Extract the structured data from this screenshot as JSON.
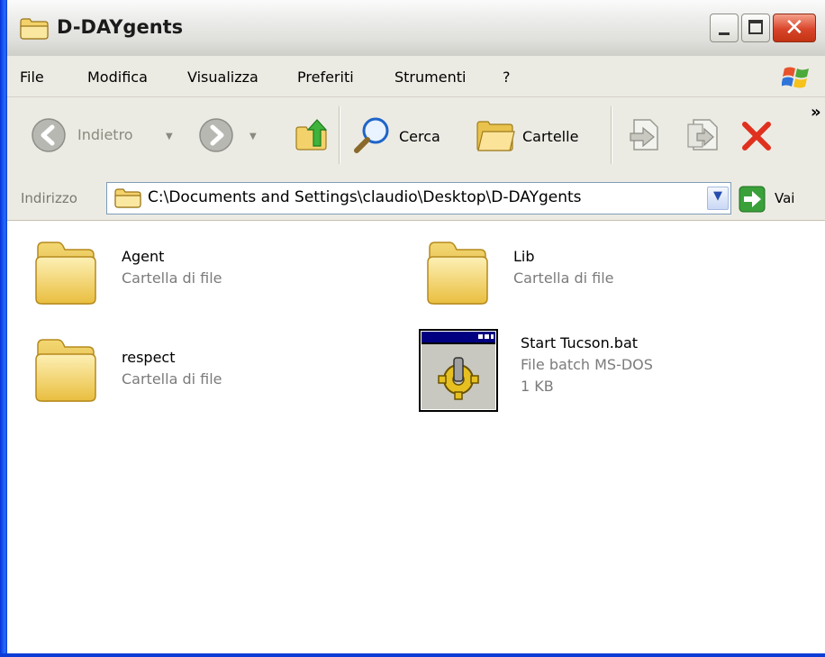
{
  "window": {
    "title": "D-DAYgents"
  },
  "menu": {
    "items": [
      "File",
      "Modifica",
      "Visualizza",
      "Preferiti",
      "Strumenti",
      "?"
    ]
  },
  "toolbar": {
    "back_label": "Indietro",
    "search_label": "Cerca",
    "folders_label": "Cartelle",
    "more_label": "»"
  },
  "address": {
    "label": "Indirizzo",
    "path": "C:\\Documents and Settings\\claudio\\Desktop\\D-DAYgents",
    "go_label": "Vai"
  },
  "files": [
    {
      "name": "Agent",
      "type": "Cartella di file",
      "size": "",
      "icon": "folder-icon"
    },
    {
      "name": "Lib",
      "type": "Cartella di file",
      "size": "",
      "icon": "folder-icon"
    },
    {
      "name": "respect",
      "type": "Cartella di file",
      "size": "",
      "icon": "folder-icon"
    },
    {
      "name": "Start Tucson.bat",
      "type": "File batch MS-DOS",
      "size": "1 KB",
      "icon": "batch-file-icon"
    }
  ],
  "colors": {
    "title_frame": "#0b3dd6",
    "menu_bg": "#ecebe3",
    "folder_yellow": "#f6d56a",
    "delete_red": "#e0301e",
    "go_green": "#3aa13a"
  }
}
